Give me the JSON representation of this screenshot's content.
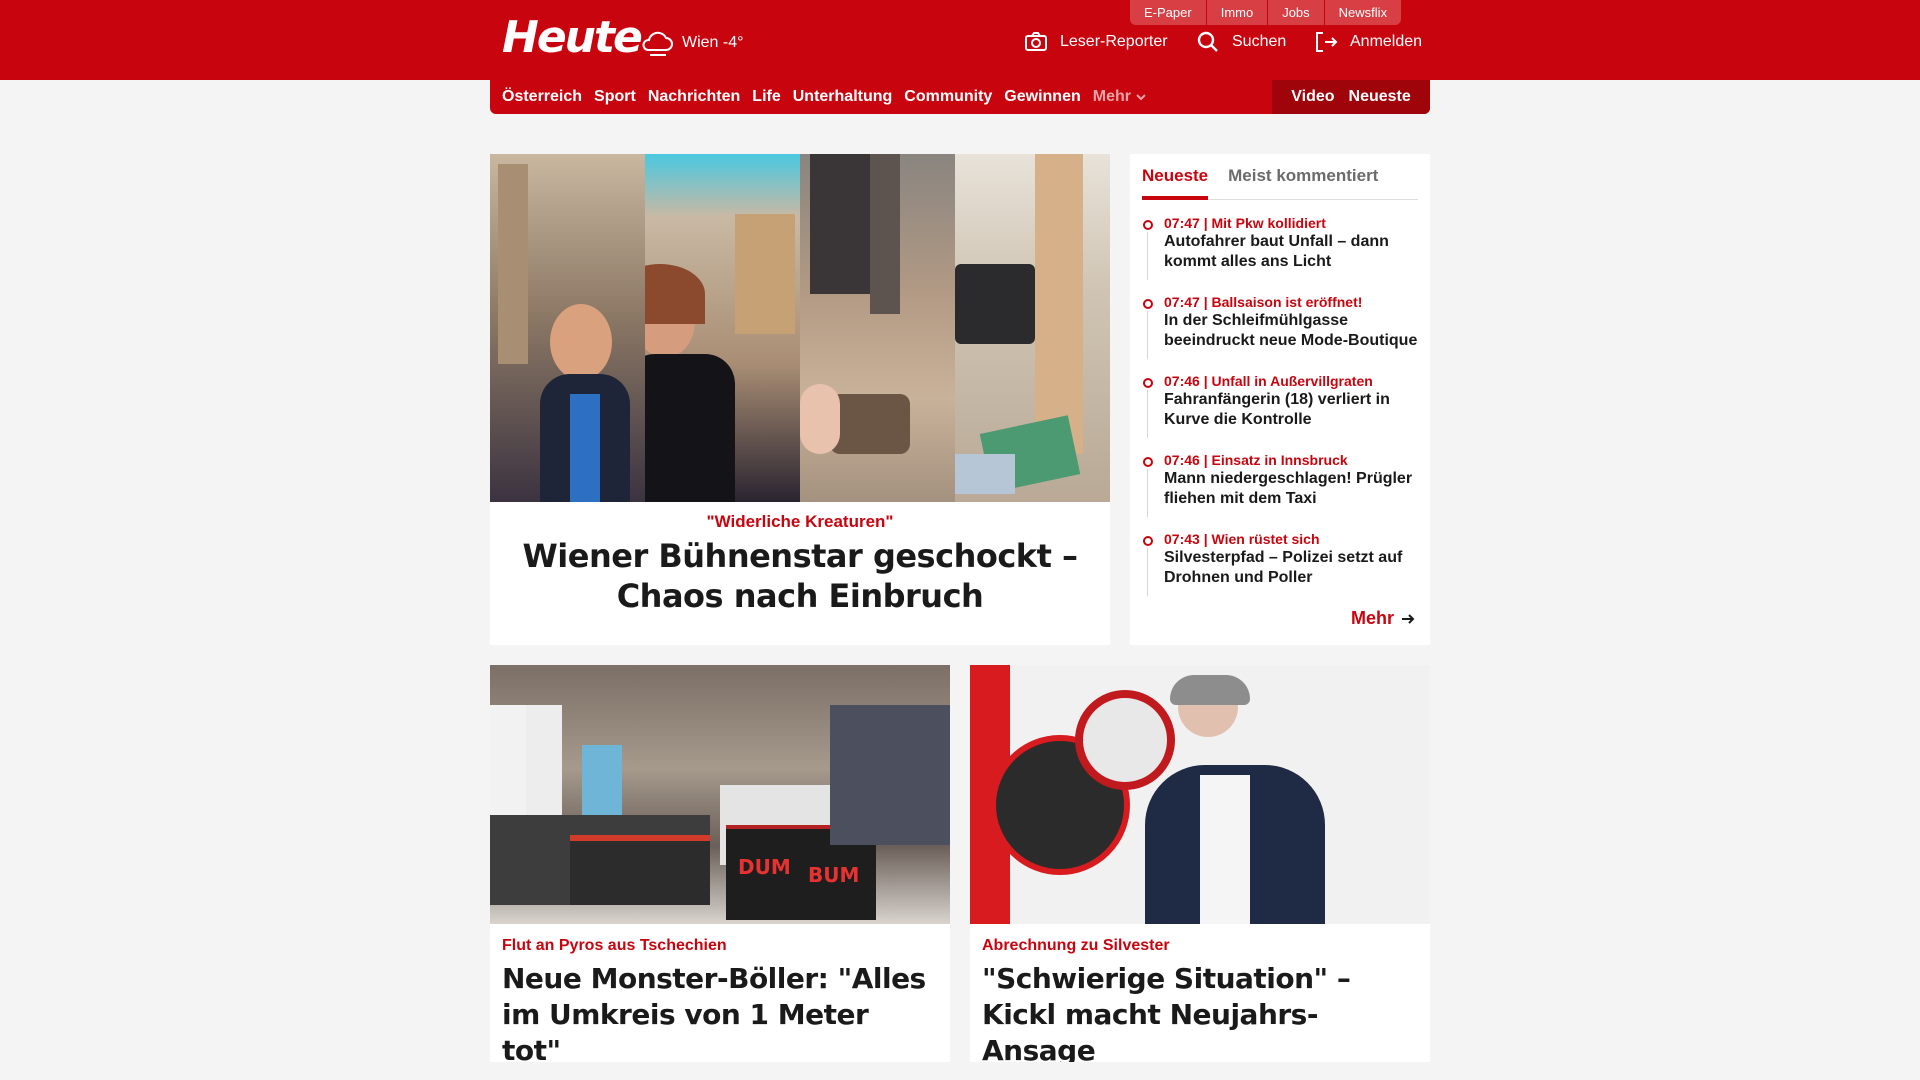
{
  "header": {
    "logo": "Heute",
    "weather": "Wien -4°",
    "top_links": [
      "E-Paper",
      "Immo",
      "Jobs",
      "Newsflix"
    ],
    "actions": {
      "reporter": "Leser-Reporter",
      "search": "Suchen",
      "login": "Anmelden"
    }
  },
  "nav": {
    "items": [
      "Österreich",
      "Sport",
      "Nachrichten",
      "Life",
      "Unterhaltung",
      "Community",
      "Gewinnen"
    ],
    "more": "Mehr",
    "video": "Video",
    "latest": "Neueste"
  },
  "hero": {
    "kicker": "\"Widerliche Kreaturen\"",
    "title": "Wiener Bühnenstar geschockt – Chaos nach Einbruch"
  },
  "sidebar": {
    "tabs": [
      "Neueste",
      "Meist kommentiert"
    ],
    "items": [
      {
        "meta": "07:47 | Mit Pkw kollidiert",
        "title": "Autofahrer baut Unfall – dann kommt alles ans Licht"
      },
      {
        "meta": "07:47 | Ballsaison ist eröffnet!",
        "title": "In der Schleifmühlgasse beeindruckt neue Mode-Boutique"
      },
      {
        "meta": "07:46 | Unfall in Außervillgraten",
        "title": "Fahranfängerin (18) verliert in Kurve die Kontrolle"
      },
      {
        "meta": "07:46 | Einsatz in Innsbruck",
        "title": "Mann niedergeschlagen! Prügler fliehen mit dem Taxi"
      },
      {
        "meta": "07:43 | Wien rüstet sich",
        "title": "Silvesterpfad – Polizei setzt auf Drohnen und Poller"
      }
    ],
    "more": "Mehr"
  },
  "cards": [
    {
      "kicker": "Flut an Pyros aus Tschechien",
      "title": "Neue Monster-Böller: \"Alles im Umkreis von 1 Meter tot\""
    },
    {
      "kicker": "Abrechnung zu Silvester",
      "title": "\"Schwierige Situation\" – Kickl macht Neujahrs-Ansage"
    }
  ],
  "image_text": {
    "dum": "DUM",
    "bum": "BUM"
  },
  "colors": {
    "brand": "#c8050f",
    "brand_dark": "#9f040b",
    "page_bg": "#f4f4f4"
  }
}
